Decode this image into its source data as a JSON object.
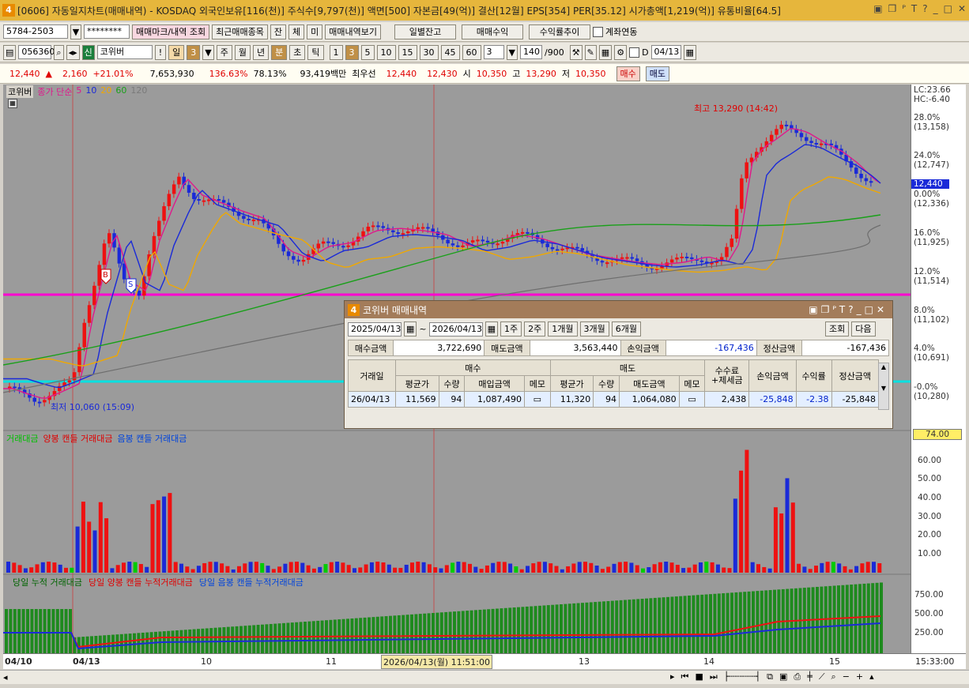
{
  "window": {
    "number": "4",
    "title": "[0606] 자동일지차트(매매내역) - KOSDAQ 외국인보유[116(천)] 주식수[9,797(천)] 액면[500] 자본금[49(억)] 결산[12월] EPS[354] PER[35.12] 시가총액[1,219(억)] 유통비율[64.5]",
    "icons": [
      "layout-icon",
      "copy-icon",
      "pin-icon",
      "font-icon",
      "help-icon",
      "minimize-icon",
      "maximize-icon",
      "close-icon"
    ],
    "icon_glyphs": [
      "▣",
      "❐",
      "ᴾ",
      "T",
      "?",
      "_",
      "□",
      "✕"
    ]
  },
  "toolbar1": {
    "account": "5784-2503",
    "password": "********",
    "btn_marks": "매매마크/내역 조회",
    "btn_recent": "최근매매종목",
    "btn_jan": "잔",
    "btn_che": "체",
    "btn_mi": "미",
    "btn_view": "매매내역보기",
    "btn_daily": "일별잔고",
    "btn_profit": "매매수익",
    "btn_trend": "수익률추이",
    "chk_link": "계좌연동"
  },
  "toolbar2": {
    "code": "056360",
    "stock_badge": "신",
    "stock_name": "코위버",
    "excl": "!",
    "period_day": "일",
    "period_num": "3",
    "btn_week": "주",
    "btn_month": "월",
    "btn_year": "년",
    "btn_min": "분",
    "btn_sec": "초",
    "btn_tick": "틱",
    "intervals": [
      "1",
      "3",
      "5",
      "10",
      "15",
      "30",
      "45",
      "60"
    ],
    "sel_interval": "3",
    "count": "140",
    "count_total": "/900",
    "chk_d": "D",
    "date": "04/13"
  },
  "quote": {
    "price": "12,440",
    "arrow": "▲",
    "change": "2,160",
    "rate": "+21.01%",
    "volume": "7,653,930",
    "vol_ratio": "136.63%",
    "turnover": "78.13%",
    "amount": "93,419백만",
    "best_label": "최우선",
    "best_ask": "12,440",
    "best_bid": "12,430",
    "open_label": "시",
    "open": "10,350",
    "high_label": "고",
    "high": "13,290",
    "low_label": "저",
    "low": "10,350",
    "buy": "매수",
    "sell": "매도"
  },
  "chart": {
    "legend_name": "코위버",
    "legend_ma": "종가 단순",
    "ma_periods": [
      "5",
      "10",
      "20",
      "60",
      "120"
    ],
    "ma_colors": [
      "#e0188c",
      "#1a2ad8",
      "#f0a800",
      "#19a019",
      "#7a7a7a"
    ],
    "high_note": "최고 13,290 (14:42)",
    "low_note": "최저 10,060 (15:09)",
    "marker_buy": "B",
    "marker_sell": "S",
    "vol_legend": [
      "거래대금",
      "양봉 캔들 거래대금",
      "음봉 캔들 거래대금"
    ],
    "cum_legend": [
      "당일 누적 거래대금",
      "당일 양봉 캔들 누적거래대금",
      "당일 음봉 캔들 누적거래대금"
    ]
  },
  "price_axis": {
    "lc": "LC:23.66",
    "hc": "HC:-6.40",
    "current": "12,440",
    "labels": [
      [
        "28.0%",
        "(13,158)"
      ],
      [
        "24.0%",
        "(12,747)"
      ],
      [
        "0.00%",
        "(12,336)"
      ],
      [
        "16.0%",
        "(11,925)"
      ],
      [
        "12.0%",
        "(11,514)"
      ],
      [
        "8.0%",
        "(11,102)"
      ],
      [
        "4.0%",
        "(10,691)"
      ],
      [
        "-0.0%",
        "(10,280)"
      ]
    ],
    "vol_current": "74.00",
    "vol_labels": [
      "60.00",
      "50.00",
      "40.00",
      "30.00",
      "20.00",
      "10.00"
    ],
    "cum_labels": [
      "750.00",
      "500.00",
      "250.00"
    ]
  },
  "time_axis": {
    "labels": [
      "04/10",
      "04/13",
      "10",
      "11",
      "13",
      "14",
      "15"
    ],
    "cursor": "2026/04/13(월) 11:51:00",
    "right": "15:33:00"
  },
  "dialog": {
    "number": "4",
    "title": "코위버 매매내역",
    "from": "2025/04/13",
    "to": "2026/04/13",
    "ranges": [
      "1주",
      "2주",
      "1개월",
      "3개월",
      "6개월"
    ],
    "btn_query": "조회",
    "btn_next": "다음",
    "summary": {
      "buy_label": "매수금액",
      "buy": "3,722,690",
      "sell_label": "매도금액",
      "sell": "3,563,440",
      "pl_label": "손익금액",
      "pl": "-167,436",
      "settle_label": "정산금액",
      "settle": "-167,436"
    },
    "head": {
      "date": "거래일",
      "buy": "매수",
      "sell": "매도",
      "fee": "수수료\n+제세금",
      "pl": "손익금액",
      "rate": "수익률",
      "settle": "정산금액",
      "avg": "평균가",
      "qty": "수량",
      "buyamt": "매입금액",
      "memo": "메모",
      "sellamt": "매도금액"
    },
    "rows": [
      {
        "date": "26/04/13",
        "buy_avg": "11,569",
        "buy_qty": "94",
        "buy_amt": "1,087,490",
        "sell_avg": "11,320",
        "sell_qty": "94",
        "sell_amt": "1,064,080",
        "fee": "2,438",
        "pl": "-25,848",
        "rate": "-2.38",
        "settle": "-25,848"
      }
    ]
  }
}
